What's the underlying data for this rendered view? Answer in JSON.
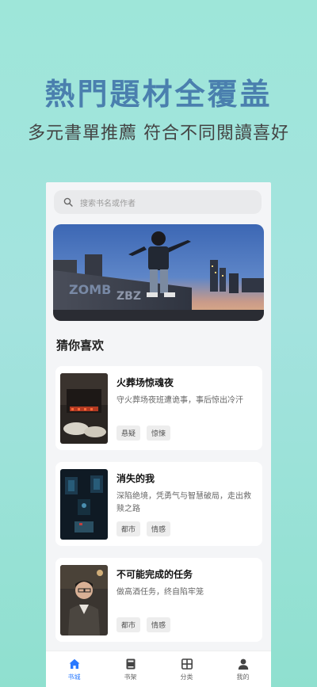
{
  "promo": {
    "headline": "熱門題材全覆盖",
    "subline": "多元書單推薦 符合不同閱讀喜好"
  },
  "search": {
    "placeholder": "搜索书名或作者"
  },
  "section": {
    "title": "猜你喜欢"
  },
  "books": [
    {
      "title": "火葬场惊魂夜",
      "desc": "守火葬场夜班遭诡事，事后惊出冷汗",
      "tags": [
        "悬疑",
        "惊悚"
      ]
    },
    {
      "title": "消失的我",
      "desc": "深陷绝境，凭勇气与智慧破局，走出救赎之路",
      "tags": [
        "都市",
        "情感"
      ]
    },
    {
      "title": "不可能完成的任务",
      "desc": "做高酒任务，终自陷牢笼",
      "tags": [
        "都市",
        "情感"
      ]
    }
  ],
  "tabbar": {
    "items": [
      {
        "label": "书城",
        "icon": "home-icon",
        "active": true
      },
      {
        "label": "书架",
        "icon": "bookshelf-icon",
        "active": false
      },
      {
        "label": "分类",
        "icon": "category-icon",
        "active": false
      },
      {
        "label": "我的",
        "icon": "profile-icon",
        "active": false
      }
    ]
  },
  "colors": {
    "accent": "#2979ff",
    "headline": "#4a7fae"
  }
}
